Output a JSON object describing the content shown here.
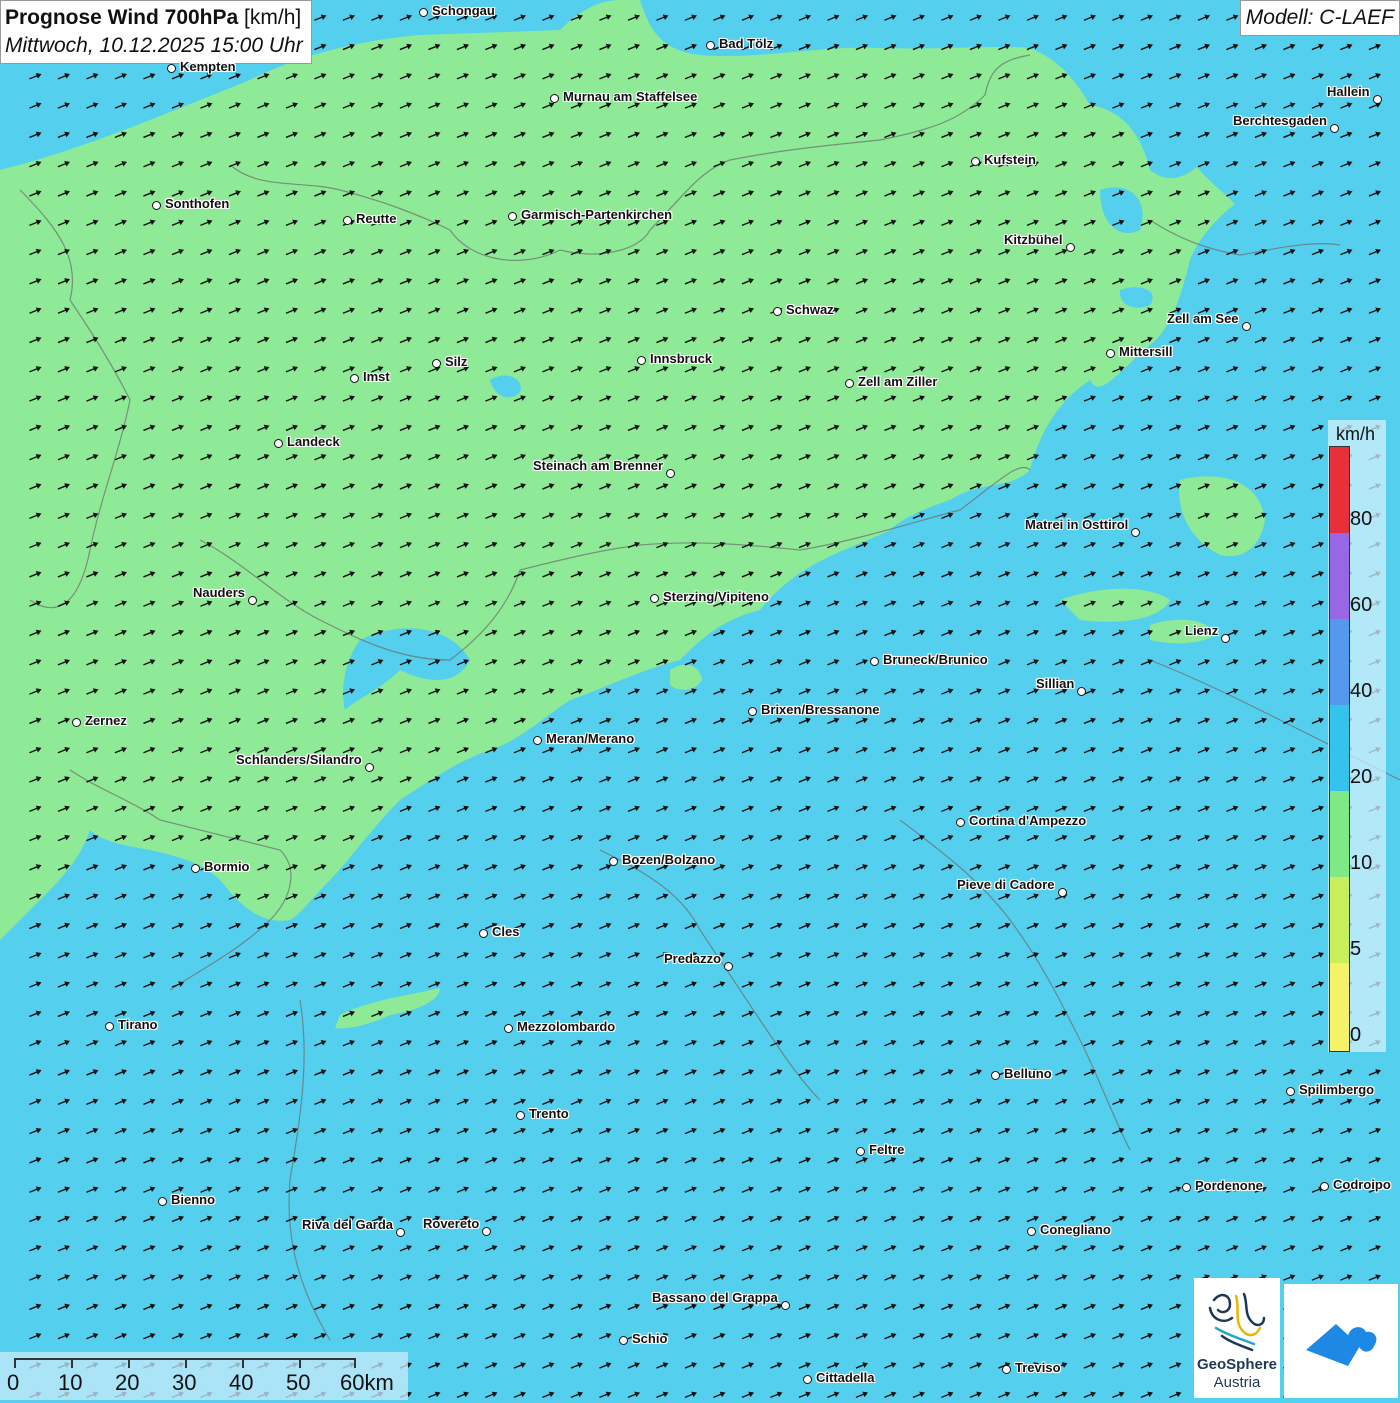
{
  "title": {
    "main": "Prognose Wind 700hPa",
    "unit": "[km/h]",
    "datetime": "Mittwoch, 10.12.2025 15:00 Uhr"
  },
  "model": "Modell: C-LAEF",
  "legend": {
    "unit": "km/h",
    "labels": [
      "80",
      "60",
      "40",
      "20",
      "10",
      "5",
      "0"
    ],
    "colors": [
      "#e8303a",
      "#9966e6",
      "#5599ee",
      "#33c3ec",
      "#7fe887",
      "#c8ef5a",
      "#f5f26a"
    ]
  },
  "scale_bar": {
    "labels": [
      "0",
      "10",
      "20",
      "30",
      "40",
      "50",
      "60km"
    ]
  },
  "colors": {
    "calm_zone": "#8eea96",
    "windy_zone": "#55cfee",
    "accent": "#1c3a57"
  },
  "branding": {
    "name": "GeoSphere",
    "sub": "Austria"
  },
  "cities": [
    {
      "name": "Schongau"
    },
    {
      "name": "Bad Tölz"
    },
    {
      "name": "Kempten"
    },
    {
      "name": "Murnau am Staffelsee"
    },
    {
      "name": "Hallein"
    },
    {
      "name": "Berchtesgaden"
    },
    {
      "name": "Kufstein"
    },
    {
      "name": "Sonthofen"
    },
    {
      "name": "Reutte"
    },
    {
      "name": "Garmisch-Partenkirchen"
    },
    {
      "name": "Kitzbühel"
    },
    {
      "name": "Schwaz"
    },
    {
      "name": "Zell am See"
    },
    {
      "name": "Mittersill"
    },
    {
      "name": "Innsbruck"
    },
    {
      "name": "Silz"
    },
    {
      "name": "Imst"
    },
    {
      "name": "Zell am Ziller"
    },
    {
      "name": "Landeck"
    },
    {
      "name": "Steinach am Brenner"
    },
    {
      "name": "Matrei in Osttirol"
    },
    {
      "name": "Nauders"
    },
    {
      "name": "Sterzing/Vipiteno"
    },
    {
      "name": "Lienz"
    },
    {
      "name": "Bruneck/Brunico"
    },
    {
      "name": "Sillian"
    },
    {
      "name": "Zernez"
    },
    {
      "name": "Brixen/Bressanone"
    },
    {
      "name": "Meran/Merano"
    },
    {
      "name": "Schlanders/Silandro"
    },
    {
      "name": "Cortina d'Ampezzo"
    },
    {
      "name": "Bozen/Bolzano"
    },
    {
      "name": "Bormio"
    },
    {
      "name": "Pieve di Cadore"
    },
    {
      "name": "Cles"
    },
    {
      "name": "Predazzo"
    },
    {
      "name": "Tirano"
    },
    {
      "name": "Mezzolombardo"
    },
    {
      "name": "Belluno"
    },
    {
      "name": "Spilimbergo"
    },
    {
      "name": "Trento"
    },
    {
      "name": "Feltre"
    },
    {
      "name": "Pordenone"
    },
    {
      "name": "Codroipo"
    },
    {
      "name": "Bienno"
    },
    {
      "name": "Riva del Garda"
    },
    {
      "name": "Rovereto"
    },
    {
      "name": "Conegliano"
    },
    {
      "name": "Bassano del Grappa"
    },
    {
      "name": "Schio"
    },
    {
      "name": "Treviso"
    },
    {
      "name": "Cittadella"
    }
  ]
}
